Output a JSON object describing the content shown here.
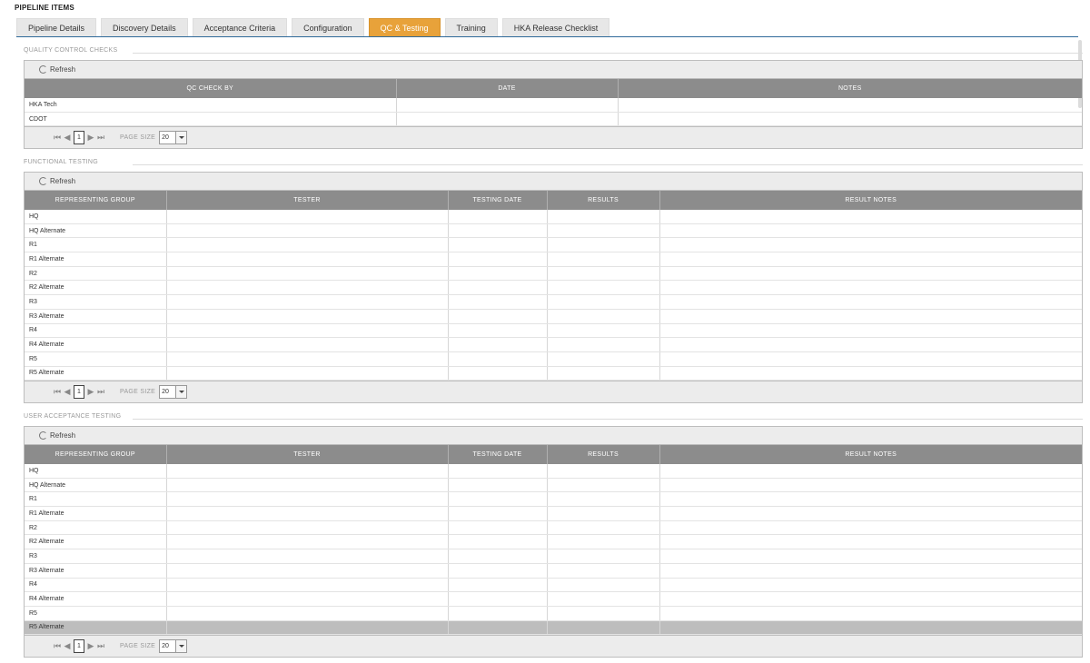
{
  "page_title": "PIPELINE ITEMS",
  "tabs": [
    "Pipeline Details",
    "Discovery Details",
    "Acceptance Criteria",
    "Configuration",
    "QC & Testing",
    "Training",
    "HKA Release Checklist"
  ],
  "active_tab": "QC & Testing",
  "qc": {
    "legend": "QUALITY CONTROL CHECKS",
    "refresh": "Refresh",
    "columns": [
      "QC CHECK BY",
      "DATE",
      "NOTES"
    ],
    "rows": [
      "HKA Tech",
      "CDOT"
    ],
    "pager": {
      "page": "1",
      "label": "PAGE SIZE",
      "size": "20"
    }
  },
  "functional": {
    "legend": "FUNCTIONAL TESTING",
    "refresh": "Refresh",
    "columns": [
      "REPRESENTING GROUP",
      "TESTER",
      "TESTING DATE",
      "RESULTS",
      "RESULT NOTES"
    ],
    "rows": [
      "HQ",
      "HQ Alternate",
      "R1",
      "R1 Alternate",
      "R2",
      "R2 Alternate",
      "R3",
      "R3 Alternate",
      "R4",
      "R4 Alternate",
      "R5",
      "R5 Alternate"
    ],
    "pager": {
      "page": "1",
      "label": "PAGE SIZE",
      "size": "20"
    }
  },
  "uat": {
    "legend": "USER ACCEPTANCE TESTING",
    "refresh": "Refresh",
    "columns": [
      "REPRESENTING GROUP",
      "TESTER",
      "TESTING DATE",
      "RESULTS",
      "RESULT NOTES"
    ],
    "rows": [
      "HQ",
      "HQ Alternate",
      "R1",
      "R1 Alternate",
      "R2",
      "R2 Alternate",
      "R3",
      "R3 Alternate",
      "R4",
      "R4 Alternate",
      "R5",
      "R5 Alternate"
    ],
    "selected_row": "R5 Alternate",
    "pager": {
      "page": "1",
      "label": "PAGE SIZE",
      "size": "20"
    }
  }
}
